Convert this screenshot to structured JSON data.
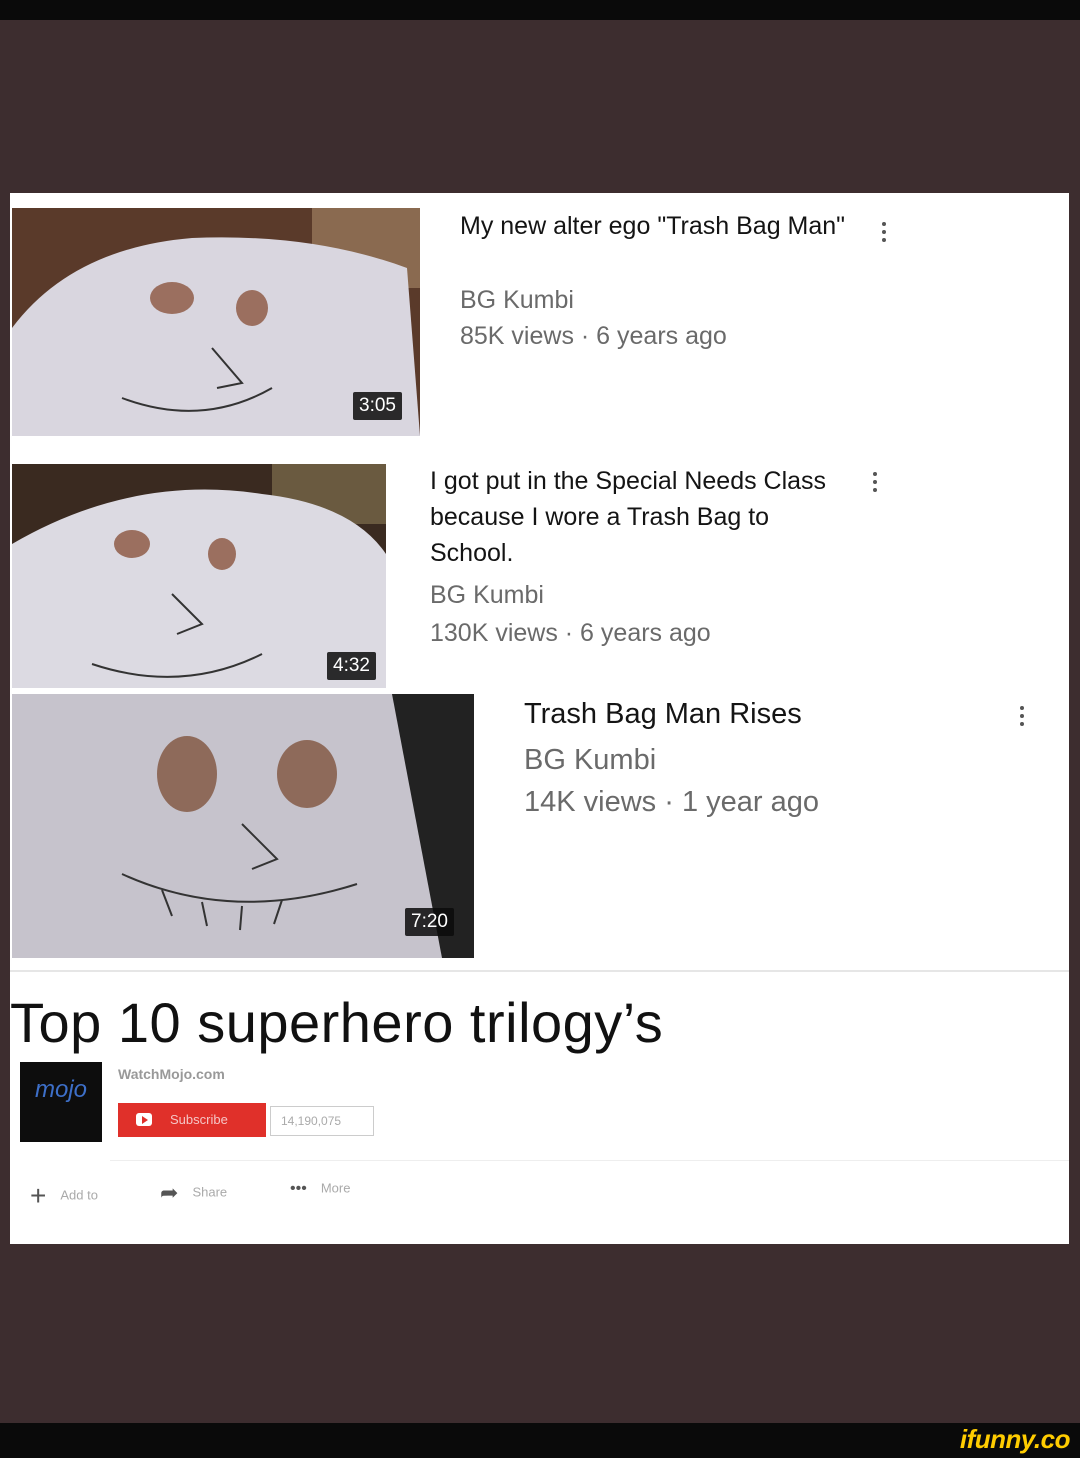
{
  "videos": [
    {
      "title": "My new alter ego \"Trash Bag Man\"",
      "channel": "BG Kumbi",
      "meta": "85K views · 6 years ago",
      "duration": "3:05"
    },
    {
      "title": "I got put in the Special Needs Class because I wore a Trash Bag to School.",
      "channel": "BG Kumbi",
      "meta": "130K views · 6 years ago",
      "duration": "4:32"
    },
    {
      "title": "Trash Bag Man Rises",
      "channel": "BG Kumbi",
      "meta": "14K views · 1 year ago",
      "duration": "7:20"
    }
  ],
  "featured": {
    "title": "Top 10 superhero trilogy’s",
    "channel_logo_text": "mojo",
    "channel_name": "WatchMojo.com",
    "subscribe_label": "Subscribe",
    "subscriber_count": "14,190,075",
    "actions": {
      "add_label": "Add to",
      "share_label": "Share",
      "more_label": "More"
    }
  },
  "watermark": "ifunny.co",
  "icons": [
    "kebab-menu-icon",
    "plus-icon",
    "share-arrow-icon",
    "more-dots-icon",
    "youtube-logo-icon"
  ],
  "colors": {
    "subscribe": "#e0302a",
    "frame": "#3d2d2f",
    "watermark": "#ffcc00"
  }
}
